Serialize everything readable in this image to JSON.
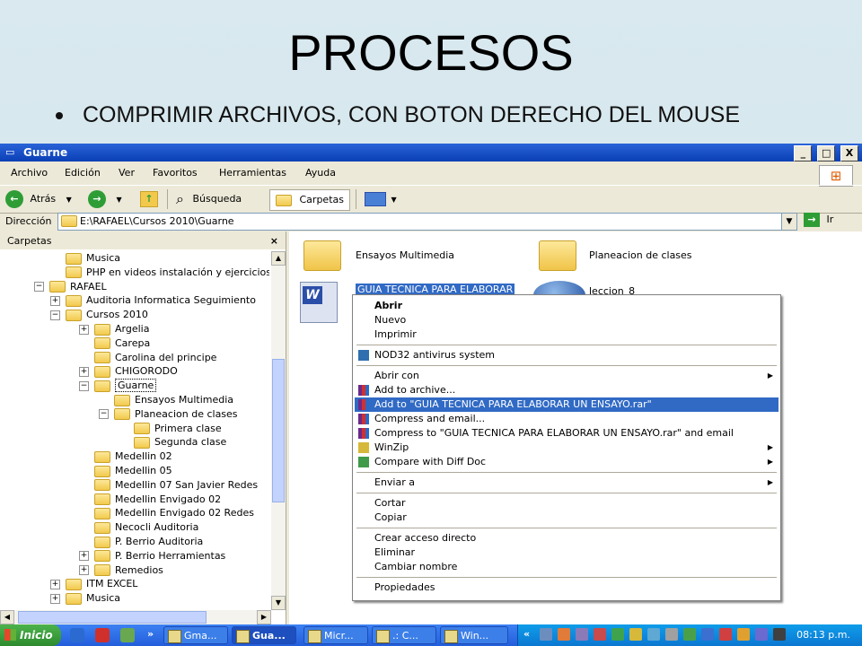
{
  "slide": {
    "title": "PROCESOS",
    "bullet": "COMPRIMIR ARCHIVOS, CON BOTON DERECHO DEL MOUSE"
  },
  "window": {
    "title": "Guarne",
    "buttons": [
      "_",
      "□",
      "X"
    ]
  },
  "menubar": [
    "Archivo",
    "Edición",
    "Ver",
    "Favoritos",
    "Herramientas",
    "Ayuda"
  ],
  "toolbar": {
    "back": "Atrás",
    "search": "Búsqueda",
    "folders": "Carpetas"
  },
  "address": {
    "label": "Dirección",
    "value": "E:\\RAFAEL\\Cursos 2010\\Guarne",
    "go": "Ir"
  },
  "folders_pane": {
    "title": "Carpetas",
    "close": "×",
    "tree": [
      {
        "label": "Musica",
        "exp": ""
      },
      {
        "label": "PHP en videos instalación y ejercicios",
        "exp": ""
      },
      {
        "label": "RAFAEL",
        "exp": "−"
      },
      {
        "label": "Auditoria Informatica Seguimiento",
        "exp": "+"
      },
      {
        "label": "Cursos 2010",
        "exp": "−"
      },
      {
        "label": "Argelia",
        "exp": "+"
      },
      {
        "label": "Carepa",
        "exp": ""
      },
      {
        "label": "Carolina del principe",
        "exp": ""
      },
      {
        "label": "CHIGORODO",
        "exp": "+"
      },
      {
        "label": "Guarne",
        "exp": "−"
      },
      {
        "label": "Ensayos Multimedia",
        "exp": ""
      },
      {
        "label": "Planeacion de clases",
        "exp": "−"
      },
      {
        "label": "Primera clase",
        "exp": ""
      },
      {
        "label": "Segunda clase",
        "exp": ""
      },
      {
        "label": "Medellin 02",
        "exp": ""
      },
      {
        "label": "Medellin 05",
        "exp": ""
      },
      {
        "label": "Medellin 07 San Javier Redes",
        "exp": ""
      },
      {
        "label": "Medellin Envigado 02",
        "exp": ""
      },
      {
        "label": "Medellin Envigado 02 Redes",
        "exp": ""
      },
      {
        "label": "Necocli Auditoria",
        "exp": ""
      },
      {
        "label": "P. Berrio Auditoria",
        "exp": ""
      },
      {
        "label": "P. Berrio Herramientas",
        "exp": "+"
      },
      {
        "label": "Remedios",
        "exp": "+"
      },
      {
        "label": "ITM EXCEL",
        "exp": "+"
      },
      {
        "label": "Musica",
        "exp": "+"
      }
    ]
  },
  "files": {
    "folder1": "Ensayos Multimedia",
    "folder2": "Planeacion de clases",
    "doc": "GUIA TECNICA PARA ELABORAR",
    "other": "leccion_8"
  },
  "context_menu": {
    "items": [
      {
        "label": "Abrir",
        "bold": true
      },
      {
        "label": "Nuevo"
      },
      {
        "label": "Imprimir"
      },
      {
        "sep": true
      },
      {
        "label": "NOD32 antivirus system",
        "icon": "nod32-icon"
      },
      {
        "sep": true
      },
      {
        "label": "Abrir con",
        "arrow": true
      },
      {
        "label": "Add to archive...",
        "icon": "winrar-icon"
      },
      {
        "label": "Add to \"GUIA TECNICA PARA ELABORAR UN ENSAYO.rar\"",
        "icon": "winrar-icon",
        "highlight": true
      },
      {
        "label": "Compress and email...",
        "icon": "winrar-icon"
      },
      {
        "label": "Compress to \"GUIA TECNICA PARA ELABORAR UN ENSAYO.rar\" and email",
        "icon": "winrar-icon"
      },
      {
        "label": "WinZip",
        "icon": "winzip-icon",
        "arrow": true
      },
      {
        "label": "Compare with Diff Doc",
        "icon": "diffdoc-icon",
        "arrow": true
      },
      {
        "sep": true
      },
      {
        "label": "Enviar a",
        "arrow": true
      },
      {
        "sep": true
      },
      {
        "label": "Cortar"
      },
      {
        "label": "Copiar"
      },
      {
        "sep": true
      },
      {
        "label": "Crear acceso directo"
      },
      {
        "label": "Eliminar"
      },
      {
        "label": "Cambiar nombre"
      },
      {
        "sep": true
      },
      {
        "label": "Propiedades"
      }
    ]
  },
  "taskbar": {
    "start": "Inicio",
    "more": "»",
    "tasks": [
      {
        "label": "Gma...",
        "active": false
      },
      {
        "label": "Gua...",
        "active": true
      },
      {
        "label": "Micr...",
        "active": false
      },
      {
        "label": ".: C...",
        "active": false
      },
      {
        "label": "Win...",
        "active": false
      }
    ],
    "tray_collapse": "«",
    "clock": "08:13 p.m."
  }
}
